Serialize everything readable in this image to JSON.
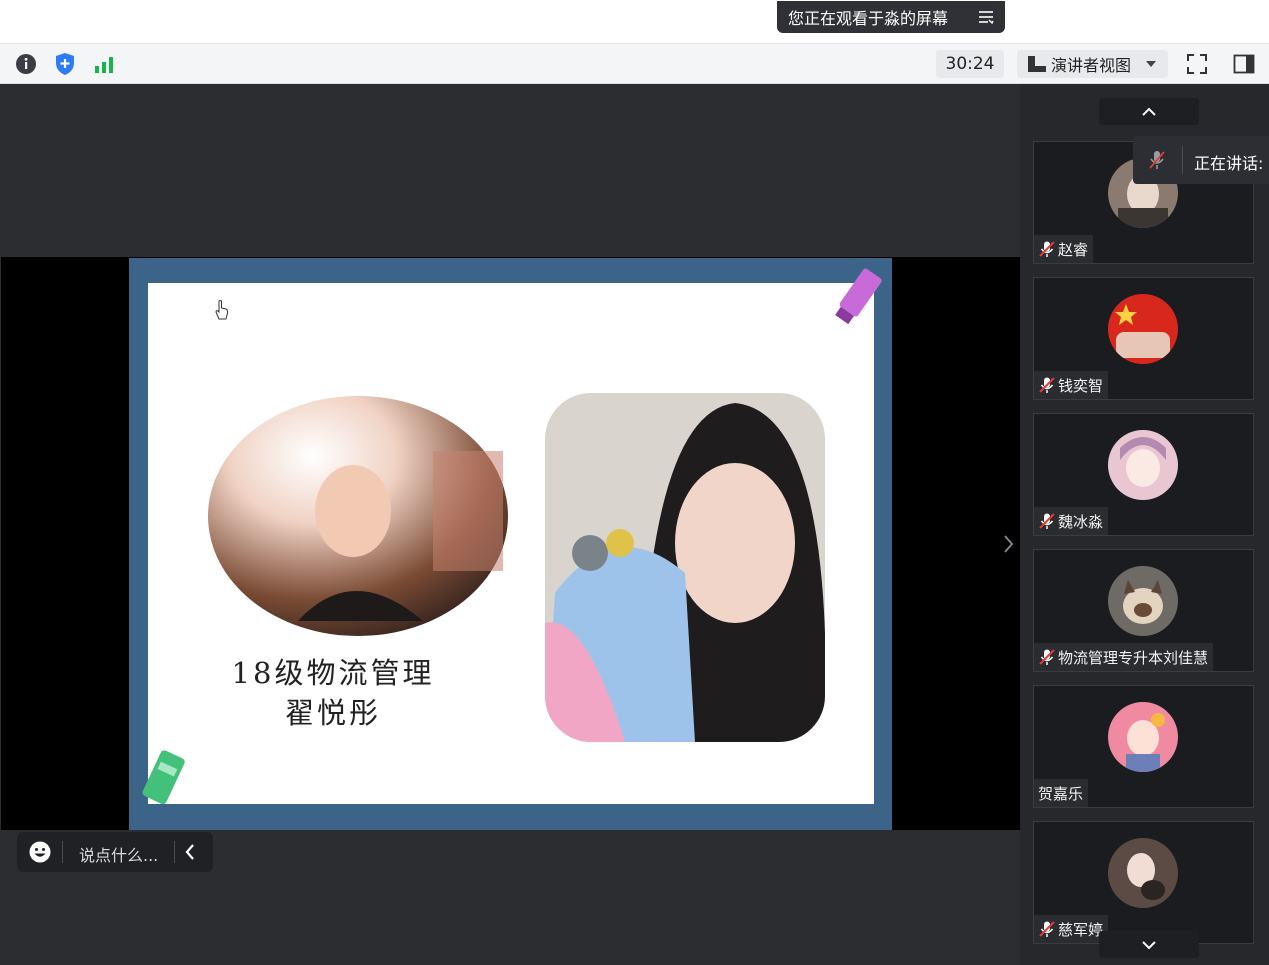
{
  "banner": {
    "text": "您正在观看于淼的屏幕",
    "icon": "menu-lines-icon"
  },
  "toolbar": {
    "timer": "30:24",
    "view_label": "演讲者视图",
    "icons": [
      "info-icon",
      "security-shield-icon",
      "signal-bars-icon",
      "fullscreen-icon",
      "panel-toggle-icon"
    ],
    "colors": {
      "shield": "#2f7bf5",
      "signal": "#19b34a"
    }
  },
  "slide": {
    "title_line1": "18级物流管理",
    "title_line2": "翟悦彤",
    "colors": {
      "frame": "#3c6488",
      "canvas": "#ffffff",
      "marker": "#c86ad8",
      "sharpener": "#43c07a"
    }
  },
  "chat": {
    "placeholder": "说点什么..."
  },
  "speaking": {
    "label": "正在讲话:"
  },
  "participants": [
    {
      "name": "赵睿",
      "muted": true,
      "avatar_color": "#8a7a70"
    },
    {
      "name": "钱奕智",
      "muted": true,
      "avatar_color": "#d8281e"
    },
    {
      "name": "魏冰淼",
      "muted": true,
      "avatar_color": "#e9c7d2"
    },
    {
      "name": "物流管理专升本刘佳慧",
      "muted": true,
      "avatar_color": "#6e6a66"
    },
    {
      "name": "贺嘉乐",
      "muted": false,
      "avatar_color": "#f08aa0"
    },
    {
      "name": "慈军婷",
      "muted": true,
      "avatar_color": "#5c4a44"
    }
  ]
}
